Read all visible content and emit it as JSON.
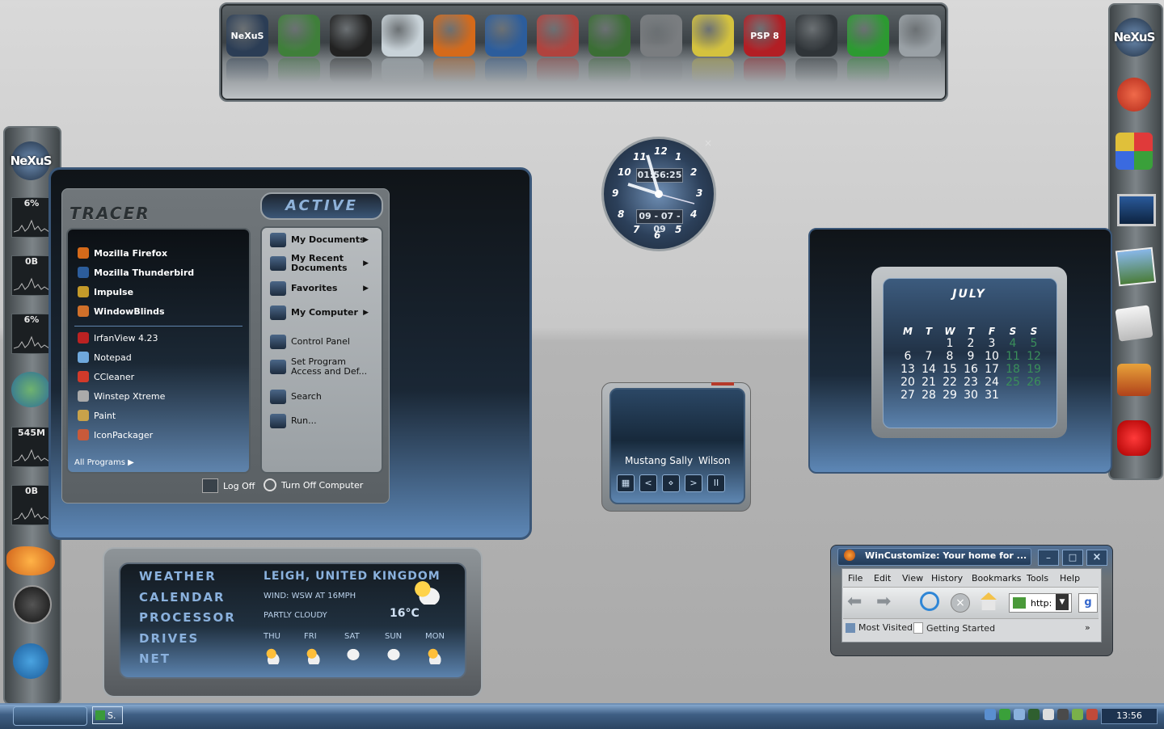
{
  "dock": {
    "icons": [
      {
        "name": "nexus-icon",
        "label": "NeXuS",
        "color": "#2b3d55"
      },
      {
        "name": "windows-icon",
        "label": "",
        "color": "#3f7f3a"
      },
      {
        "name": "clock-app-icon",
        "label": "",
        "color": "#222"
      },
      {
        "name": "recycle-bin-icon",
        "label": "",
        "color": "#c8d2d8"
      },
      {
        "name": "firefox-icon",
        "label": "",
        "color": "#d56a1a"
      },
      {
        "name": "thunderbird-icon",
        "label": "",
        "color": "#2c5d9c"
      },
      {
        "name": "uninstall-icon",
        "label": "",
        "color": "#b0433e"
      },
      {
        "name": "camera-icon",
        "label": "",
        "color": "#3b6e35"
      },
      {
        "name": "news-icon",
        "label": "",
        "color": "#7a7d80"
      },
      {
        "name": "paint-brushes-icon",
        "label": "",
        "color": "#d4c23e"
      },
      {
        "name": "psp8-icon",
        "label": "PSP 8",
        "color": "#b21e24"
      },
      {
        "name": "drive-icon",
        "label": "",
        "color": "#2f3438"
      },
      {
        "name": "webcam-icon",
        "label": "",
        "color": "#2c9a31"
      },
      {
        "name": "time-sync-icon",
        "label": "",
        "color": "#9aa1a6"
      }
    ]
  },
  "left_dock": {
    "logo": "NeXuS",
    "meters": [
      "6%",
      "0B",
      "6%",
      "545M",
      "0B"
    ]
  },
  "right_dock": {
    "logo": "NeXuS"
  },
  "start_menu": {
    "skin_title": "TRACER",
    "skin_status": "ACTIVE",
    "pinned": [
      "Mozilla Firefox",
      "Mozilla Thunderbird",
      "Impulse",
      "WindowBlinds"
    ],
    "recent": [
      "IrfanView 4.23",
      "Notepad",
      "CCleaner",
      "Winstep Xtreme",
      "Paint",
      "IconPackager"
    ],
    "all_programs": "All Programs",
    "right_items": [
      {
        "label": "My Documents",
        "bold": true,
        "arrow": true
      },
      {
        "label": "My Recent Documents",
        "bold": true,
        "arrow": true
      },
      {
        "label": "Favorites",
        "bold": true,
        "arrow": true
      },
      {
        "label": "My Computer",
        "bold": true,
        "arrow": true
      },
      {
        "label": "Control Panel",
        "bold": false,
        "arrow": false
      },
      {
        "label": "Set Program Access and Def...",
        "bold": false,
        "arrow": false
      },
      {
        "label": "Search",
        "bold": false,
        "arrow": false
      },
      {
        "label": "Run...",
        "bold": false,
        "arrow": false
      }
    ],
    "log_off": "Log Off",
    "turn_off": "Turn Off Computer"
  },
  "clock": {
    "time": "01:56:25",
    "date": "09 - 07 - 09",
    "numbers": [
      "12",
      "1",
      "2",
      "3",
      "4",
      "5",
      "6",
      "7",
      "8",
      "9",
      "10",
      "11"
    ]
  },
  "media": {
    "track": "Mustang Sally",
    "artist": "Wilson",
    "buttons": [
      "▦",
      "<",
      "⋄",
      ">",
      "II"
    ]
  },
  "calendar": {
    "month": "JULY",
    "days_header": [
      "M",
      "T",
      "W",
      "T",
      "F",
      "S",
      "S"
    ],
    "rows": [
      [
        "",
        "",
        "1",
        "2",
        "3",
        "4",
        "5"
      ],
      [
        "6",
        "7",
        "8",
        "9",
        "10",
        "11",
        "12"
      ],
      [
        "13",
        "14",
        "15",
        "16",
        "17",
        "18",
        "19"
      ],
      [
        "20",
        "21",
        "22",
        "23",
        "24",
        "25",
        "26"
      ],
      [
        "27",
        "28",
        "29",
        "30",
        "31",
        "",
        ""
      ]
    ]
  },
  "weather": {
    "menu": [
      "WEATHER",
      "CALENDAR",
      "PROCESSOR",
      "DRIVES",
      "NET"
    ],
    "location": "LEIGH, UNITED KINGDOM",
    "wind": "WIND: WSW AT 16MPH",
    "condition": "PARTLY CLOUDY",
    "temp": "16°C",
    "forecast": [
      "THU",
      "FRI",
      "SAT",
      "SUN",
      "MON"
    ]
  },
  "browser": {
    "title": "WinCustomize: Your home for ...",
    "menu": [
      "File",
      "Edit",
      "View",
      "History",
      "Bookmarks",
      "Tools",
      "Help"
    ],
    "address": "http:",
    "bookmarks": [
      "Most Visited",
      "Getting Started"
    ],
    "more": "»"
  },
  "taskbar": {
    "task": "S.",
    "time": "13:56"
  }
}
